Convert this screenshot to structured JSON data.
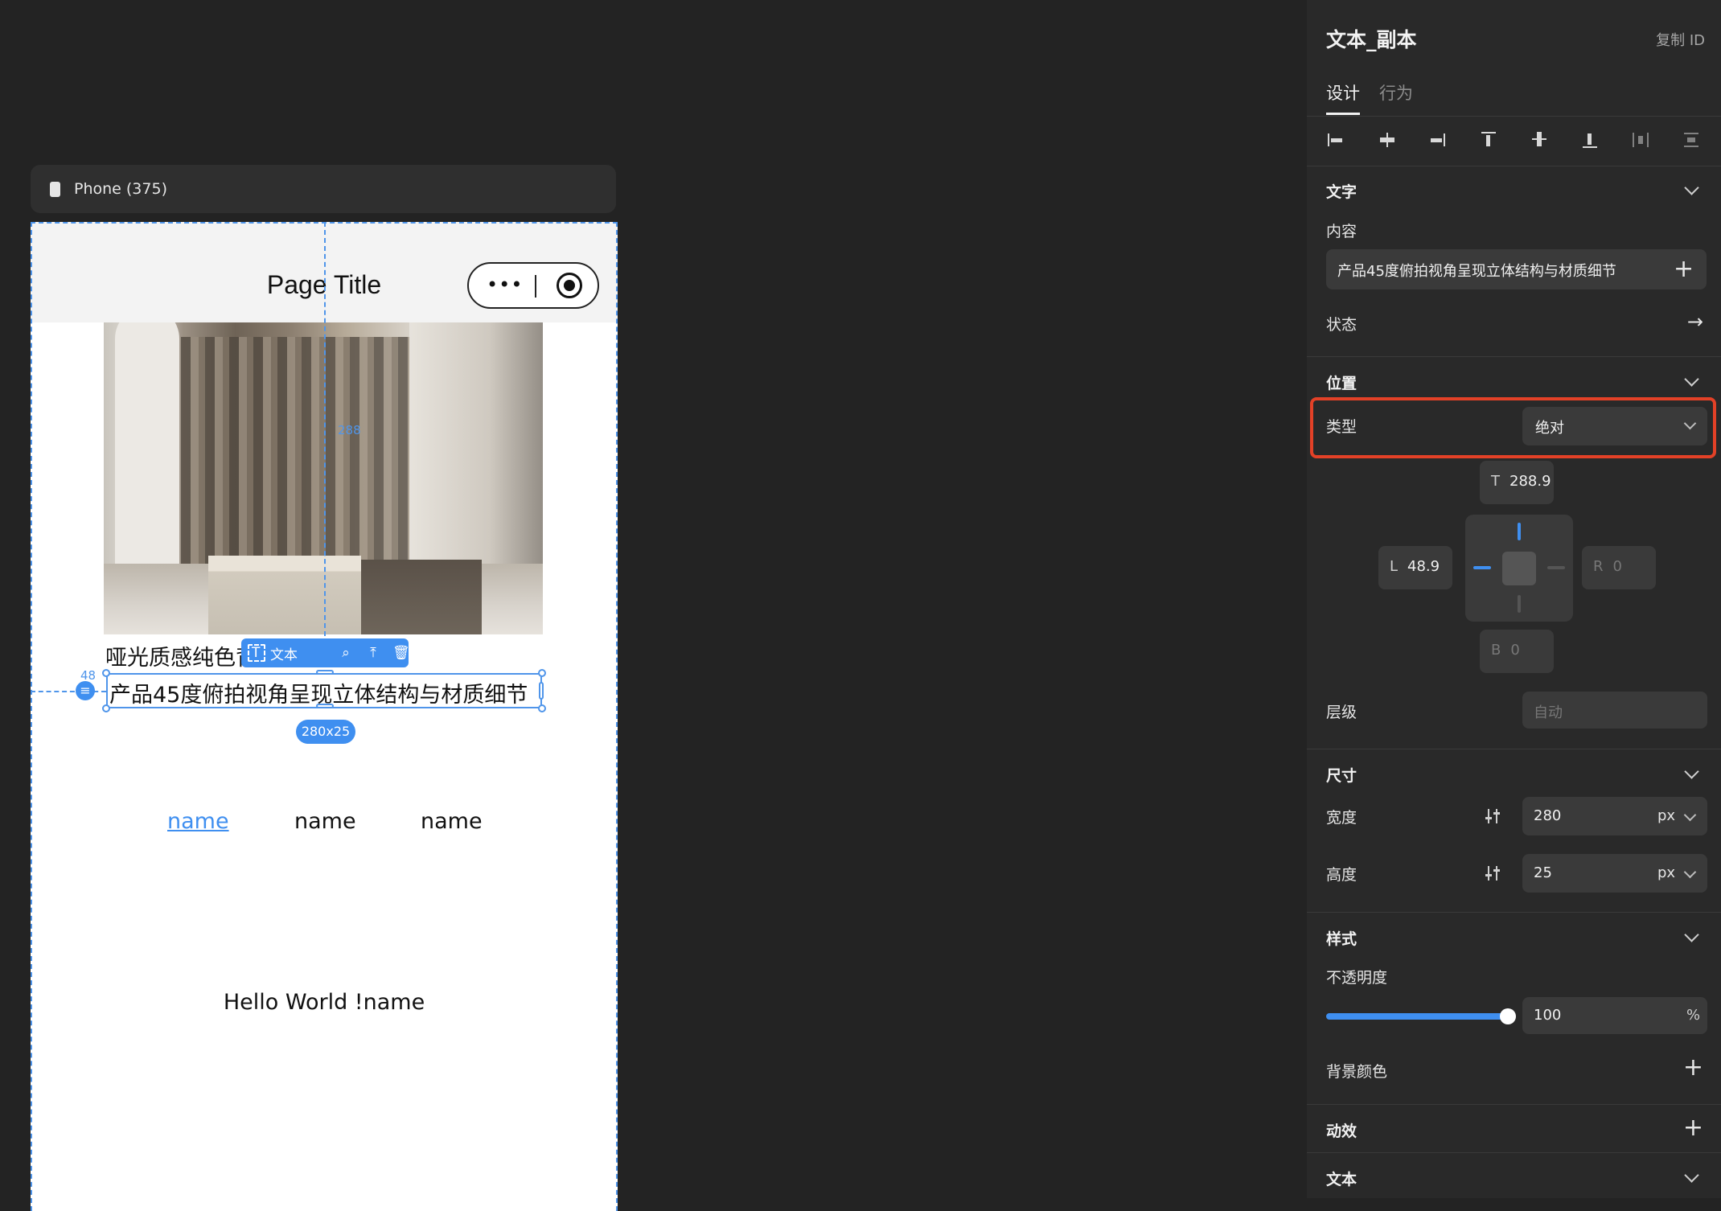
{
  "canvas": {
    "device_label": "Phone (375)",
    "page_title": "Page Title",
    "capsule_menu": "•••",
    "hero_image_icon": "interior-photo",
    "line1_text": "哑光质感纯色背",
    "selected_text": "产品45度俯拍视角呈现立体结构与材质细节",
    "toolbar_label": "文本",
    "size_badge": "280x25",
    "distance_label": "48",
    "center_guide_label": "288",
    "tabs": [
      "name",
      "name",
      "name"
    ],
    "hello_text": "Hello World !name",
    "accent_color": "#3f8ff0"
  },
  "panel": {
    "title": "文本_副本",
    "copy_id": "复制 ID",
    "tabs": [
      "设计",
      "行为"
    ],
    "text_section": {
      "title": "文字",
      "content_label": "内容",
      "content_value": "产品45度俯拍视角呈现立体结构与材质细节",
      "state_label": "状态"
    },
    "position_section": {
      "title": "位置",
      "type_label": "类型",
      "type_value": "绝对",
      "top": {
        "key": "T",
        "value": "288.9"
      },
      "left": {
        "key": "L",
        "value": "48.9"
      },
      "right": {
        "key": "R",
        "value": "0"
      },
      "bottom": {
        "key": "B",
        "value": "0"
      },
      "layer_label": "层级",
      "layer_placeholder": "自动"
    },
    "size_section": {
      "title": "尺寸",
      "width_label": "宽度",
      "width_value": "280",
      "width_unit": "px",
      "height_label": "高度",
      "height_value": "25",
      "height_unit": "px"
    },
    "style_section": {
      "title": "样式",
      "opacity_label": "不透明度",
      "opacity_value": "100",
      "opacity_unit": "%",
      "opacity_level": 1.0,
      "bg_color_label": "背景颜色"
    },
    "animation_section": {
      "title": "动效"
    },
    "text_style_section": {
      "title": "文本"
    },
    "highlight_color": "#e34127"
  }
}
